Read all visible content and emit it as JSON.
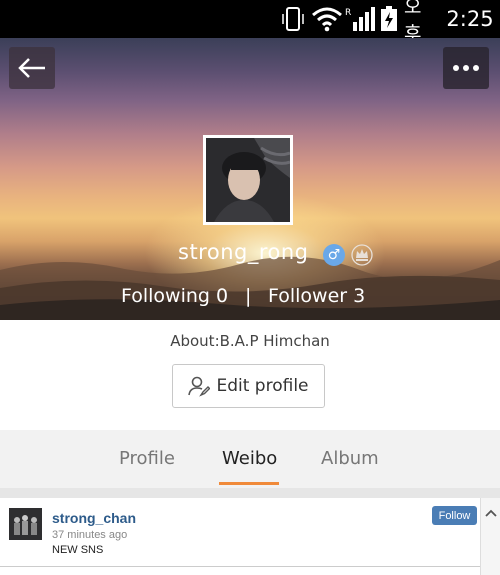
{
  "status_bar": {
    "lang": "오후",
    "time": "2:25",
    "icons": [
      "phone-vibrate-icon",
      "wifi-icon",
      "signal-icon",
      "battery-charging-icon"
    ]
  },
  "header": {
    "back_icon": "arrow-left-icon",
    "more_icon": "more-dots-icon",
    "username": "strong_rong",
    "gender_symbol": "♂",
    "crown_icon": "crown-icon",
    "following_label": "Following 0",
    "separator": "|",
    "follower_label": "Follower 3"
  },
  "about": {
    "text": "About:B.A.P Himchan"
  },
  "edit_profile": {
    "label": "Edit profile",
    "icon": "user-edit-icon"
  },
  "tabs": [
    {
      "label": "Profile",
      "active": false
    },
    {
      "label": "Weibo",
      "active": true
    },
    {
      "label": "Album",
      "active": false
    }
  ],
  "accent_color": "#f08a3a",
  "post": {
    "username": "strong_chan",
    "time": "37 minutes ago",
    "text": "NEW SNS",
    "follow_label": "Follow",
    "follow_color": "#4a7db5"
  }
}
